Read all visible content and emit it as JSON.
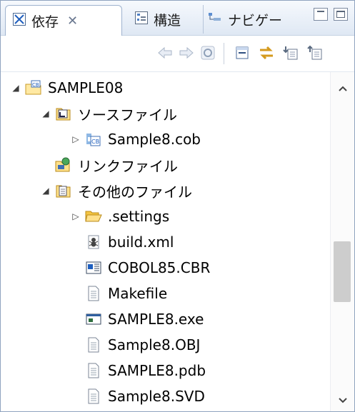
{
  "tabs": [
    {
      "label": "依存",
      "close": "✕"
    },
    {
      "label": "構造"
    },
    {
      "label": "ナビゲー"
    }
  ],
  "tree": [
    {
      "label": "SAMPLE08",
      "twisty": "◢",
      "icon": "cobol-project-icon"
    },
    {
      "label": "ソースファイル",
      "twisty": "◢",
      "icon": "source-folder-icon"
    },
    {
      "label": "Sample8.cob",
      "twisty": "▷",
      "icon": "cobol-source-file-icon"
    },
    {
      "label": "リンクファイル",
      "twisty": "",
      "icon": "link-folder-icon"
    },
    {
      "label": "その他のファイル",
      "twisty": "◢",
      "icon": "other-files-folder-icon"
    },
    {
      "label": ".settings",
      "twisty": "▷",
      "icon": "folder-icon"
    },
    {
      "label": "build.xml",
      "twisty": "",
      "icon": "ant-build-file-icon"
    },
    {
      "label": "COBOL85.CBR",
      "twisty": "",
      "icon": "cbr-file-icon"
    },
    {
      "label": "Makefile",
      "twisty": "",
      "icon": "text-file-icon"
    },
    {
      "label": "SAMPLE8.exe",
      "twisty": "",
      "icon": "exe-file-icon"
    },
    {
      "label": "Sample8.OBJ",
      "twisty": "",
      "icon": "text-file-icon"
    },
    {
      "label": "SAMPLE8.pdb",
      "twisty": "",
      "icon": "text-file-icon"
    },
    {
      "label": "Sample8.SVD",
      "twisty": "",
      "icon": "text-file-icon"
    }
  ],
  "scrollbar": {
    "position_fraction": 0.62,
    "visible_fraction": 0.21
  },
  "colors": {
    "border": "#8fa3bf",
    "accent": "#1f5fbf"
  }
}
